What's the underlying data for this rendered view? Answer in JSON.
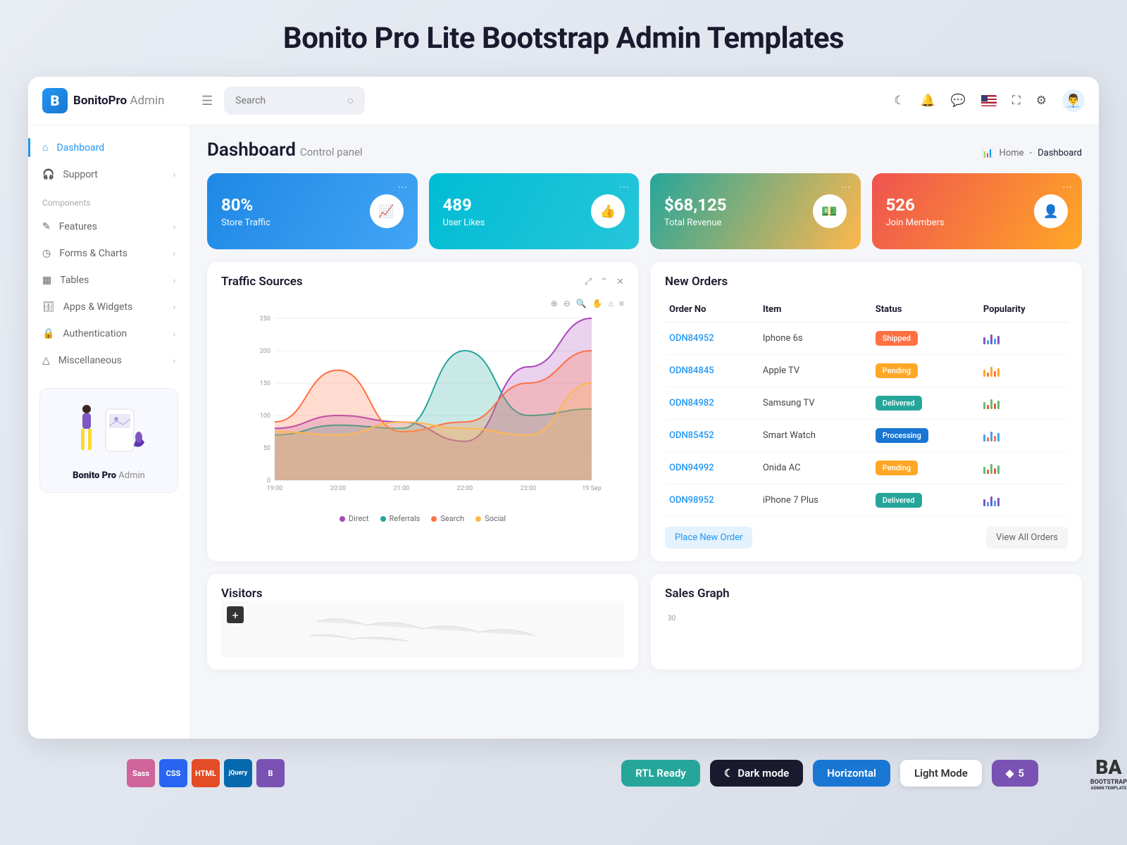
{
  "page_title": "Bonito Pro Lite Bootstrap Admin Templates",
  "logo": {
    "name_bold": "BonitoPro",
    "name_light": "Admin"
  },
  "search": {
    "placeholder": "Search"
  },
  "sidebar": {
    "items": [
      {
        "label": "Dashboard",
        "icon": "home",
        "active": true,
        "expandable": false
      },
      {
        "label": "Support",
        "icon": "headphones",
        "active": false,
        "expandable": true
      }
    ],
    "section_label": "Components",
    "components": [
      {
        "label": "Features",
        "icon": "edit"
      },
      {
        "label": "Forms & Charts",
        "icon": "clock"
      },
      {
        "label": "Tables",
        "icon": "grid"
      },
      {
        "label": "Apps & Widgets",
        "icon": "database"
      },
      {
        "label": "Authentication",
        "icon": "lock"
      },
      {
        "label": "Miscellaneous",
        "icon": "warning"
      }
    ],
    "promo": {
      "title_bold": "Bonito Pro",
      "title_light": "Admin"
    }
  },
  "header": {
    "title": "Dashboard",
    "subtitle": "Control panel",
    "breadcrumb_home": "Home",
    "breadcrumb_current": "Dashboard"
  },
  "stats": [
    {
      "value": "80%",
      "label": "Store Traffic"
    },
    {
      "value": "489",
      "label": "User Likes"
    },
    {
      "value": "$68,125",
      "label": "Total Revenue"
    },
    {
      "value": "526",
      "label": "Join Members"
    }
  ],
  "traffic_panel": {
    "title": "Traffic Sources"
  },
  "chart_data": {
    "type": "area",
    "x": [
      "19:00",
      "20:00",
      "21:00",
      "22:00",
      "23:00",
      "19 Sep"
    ],
    "ylim": [
      0,
      250
    ],
    "yticks": [
      0,
      50,
      100,
      150,
      200,
      250
    ],
    "series": [
      {
        "name": "Direct",
        "color": "#ab47bc",
        "values": [
          80,
          100,
          90,
          60,
          175,
          250
        ]
      },
      {
        "name": "Referrals",
        "color": "#26a69a",
        "values": [
          70,
          85,
          80,
          200,
          100,
          110
        ]
      },
      {
        "name": "Search",
        "color": "#ff7043",
        "values": [
          90,
          170,
          75,
          90,
          150,
          200
        ]
      },
      {
        "name": "Social",
        "color": "#ffb74d",
        "values": [
          75,
          70,
          90,
          80,
          70,
          150
        ]
      }
    ]
  },
  "orders_panel": {
    "title": "New Orders",
    "columns": [
      "Order No",
      "Item",
      "Status",
      "Popularity"
    ],
    "rows": [
      {
        "order": "ODN84952",
        "item": "Iphone 6s",
        "status": "Shipped",
        "status_class": "shipped",
        "spark": [
          "#7e57c2",
          "#42a5f5",
          "#7e57c2",
          "#42a5f5",
          "#7e57c2"
        ]
      },
      {
        "order": "ODN84845",
        "item": "Apple TV",
        "status": "Pending",
        "status_class": "pending",
        "spark": [
          "#ffa726",
          "#ff7043",
          "#ffa726",
          "#ff7043",
          "#ffa726"
        ]
      },
      {
        "order": "ODN84982",
        "item": "Samsung TV",
        "status": "Delivered",
        "status_class": "delivered",
        "spark": [
          "#66bb6a",
          "#ef5350",
          "#66bb6a",
          "#ef5350",
          "#66bb6a"
        ]
      },
      {
        "order": "ODN85452",
        "item": "Smart Watch",
        "status": "Processing",
        "status_class": "processing",
        "spark": [
          "#42a5f5",
          "#ff7043",
          "#42a5f5",
          "#ff7043",
          "#42a5f5"
        ]
      },
      {
        "order": "ODN94992",
        "item": "Onida AC",
        "status": "Pending",
        "status_class": "pending",
        "spark": [
          "#66bb6a",
          "#ef5350",
          "#66bb6a",
          "#ef5350",
          "#66bb6a"
        ]
      },
      {
        "order": "ODN98952",
        "item": "iPhone 7 Plus",
        "status": "Delivered",
        "status_class": "delivered",
        "spark": [
          "#7e57c2",
          "#42a5f5",
          "#7e57c2",
          "#42a5f5",
          "#7e57c2"
        ]
      }
    ],
    "place_btn": "Place New Order",
    "view_btn": "View All Orders"
  },
  "visitors_panel": {
    "title": "Visitors"
  },
  "sales_panel": {
    "title": "Sales Graph",
    "ytick": "30"
  },
  "footer_badges": {
    "rtl": "RTL Ready",
    "dark": "Dark mode",
    "horizontal": "Horizontal",
    "light": "Light Mode",
    "bootstrap_ver": "5",
    "bootstrap_brand": "BOOTSTRAP",
    "bootstrap_sub": "ADMIN TEMPLATE"
  }
}
